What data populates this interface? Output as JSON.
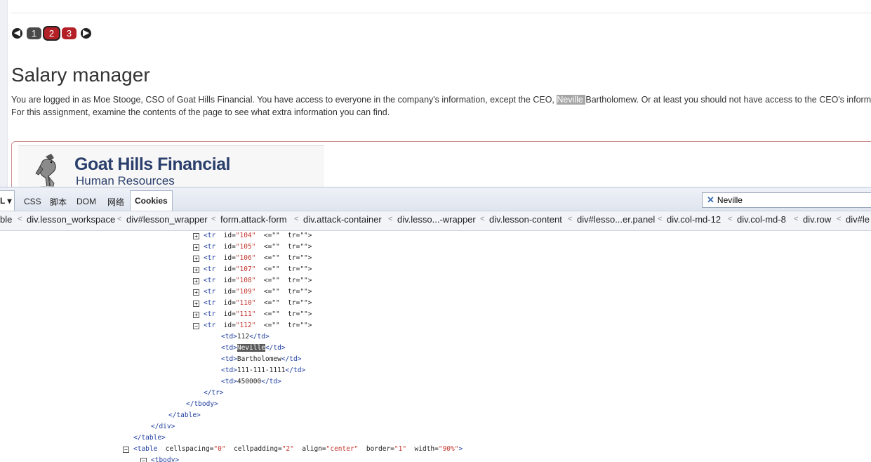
{
  "pagination": {
    "prev_icon": "arrow-left-icon",
    "pages": [
      "1",
      "2",
      "3"
    ],
    "current": "2",
    "next_icon": "arrow-right-icon"
  },
  "lesson": {
    "title": "Salary manager",
    "desc_part1": "You are logged in as Moe Stooge, CSO of Goat Hills Financial. You have access to everyone in the company's information, except the CEO, ",
    "desc_highlight": "Neville ",
    "desc_part2": "Bartholomew. Or at least you should not have access to the CEO's information. For this assignment, examine the contents of the page to see what extra information you can find."
  },
  "logo": {
    "title": "Goat Hills Financial",
    "subtitle": "Human Resources",
    "icon": "goat-icon"
  },
  "devtools": {
    "tabs": [
      "L ▾",
      "CSS",
      "脚本",
      "DOM",
      "网络",
      "Cookies"
    ],
    "search_value": "Neville",
    "breadcrumbs": [
      "ble",
      "div.lesson_workspace",
      "div#lesson_wrapper",
      "form.attack-form",
      "div.attack-container",
      "div.lesso...-wrapper",
      "div.lesson-content",
      "div#lesso...er.panel",
      "div.col-md-12",
      "div.col-md-8",
      "div.row",
      "div#le"
    ],
    "rows": [
      {
        "tag": "<tr",
        "attr": "id=",
        "val": "\"104\"",
        "rest": "<=\"\"  tr=\"\">"
      },
      {
        "tag": "<tr",
        "attr": "id=",
        "val": "\"105\"",
        "rest": "<=\"\"  tr=\"\">"
      },
      {
        "tag": "<tr",
        "attr": "id=",
        "val": "\"106\"",
        "rest": "<=\"\"  tr=\"\">"
      },
      {
        "tag": "<tr",
        "attr": "id=",
        "val": "\"107\"",
        "rest": "<=\"\"  tr=\"\">"
      },
      {
        "tag": "<tr",
        "attr": "id=",
        "val": "\"108\"",
        "rest": "<=\"\"  tr=\"\">"
      },
      {
        "tag": "<tr",
        "attr": "id=",
        "val": "\"109\"",
        "rest": "<=\"\"  tr=\"\">"
      },
      {
        "tag": "<tr",
        "attr": "id=",
        "val": "\"110\"",
        "rest": "<=\"\"  tr=\"\">"
      },
      {
        "tag": "<tr",
        "attr": "id=",
        "val": "\"111\"",
        "rest": "<=\"\"  tr=\"\">"
      },
      {
        "tag": "<tr",
        "attr": "id=",
        "val": "\"112\"",
        "rest": "<=\"\"  tr=\"\">"
      }
    ],
    "cells": [
      "112",
      "Neville",
      "Bartholomew",
      "111-111-1111",
      "450000"
    ],
    "td_open": "<td>",
    "td_close": "</td>",
    "close_tags": [
      "</tr>",
      "</tbody>",
      "</table>",
      "</div>",
      "</table>"
    ],
    "table_line": {
      "tag": "<table",
      "a1": "cellspacing=",
      "v1": "\"0\"",
      "a2": "cellpadding=",
      "v2": "\"2\"",
      "a3": "align=",
      "v3": "\"center\"",
      "a4": "border=",
      "v4": "\"1\"",
      "a5": "width=",
      "v5": "\"90%\"",
      "end": ">"
    },
    "tbody_line": "<tbody>"
  }
}
